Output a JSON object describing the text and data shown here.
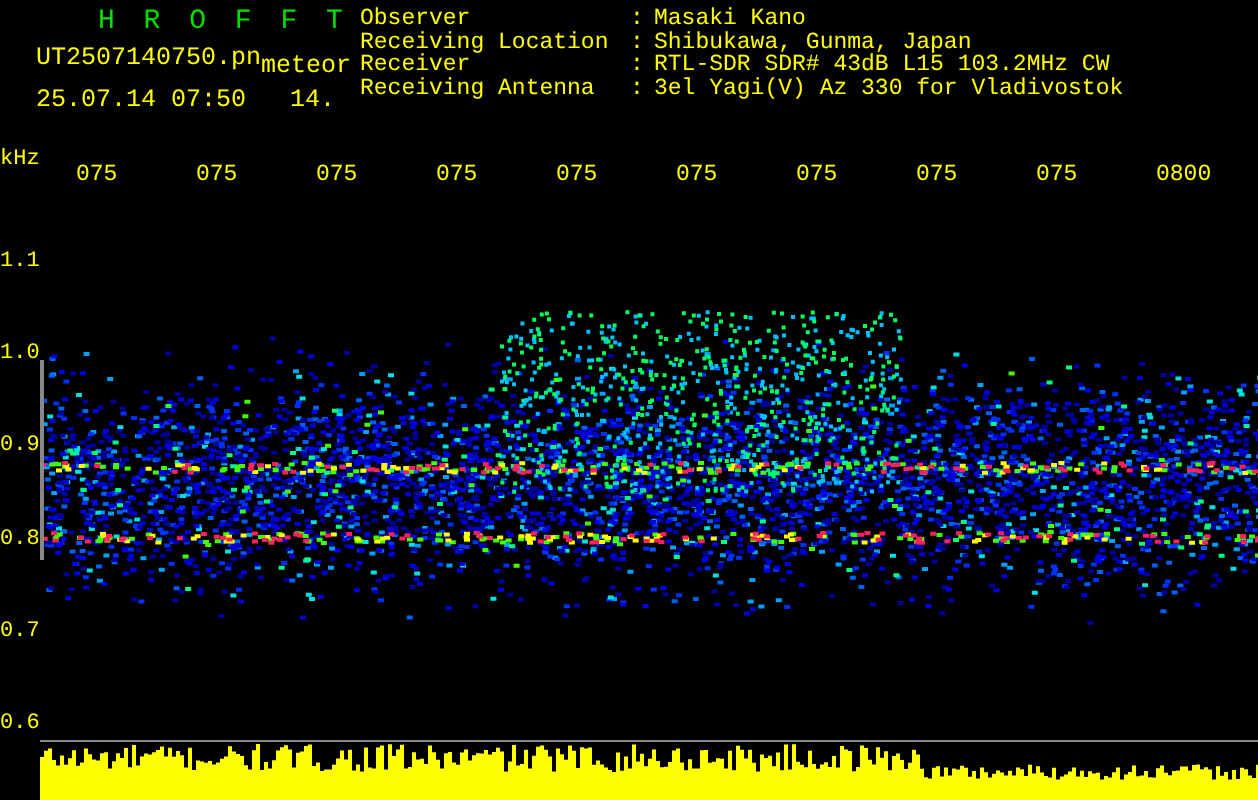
{
  "header": {
    "title": "H R O F F T",
    "filename": "UT2507140750.pn",
    "mode": "meteor",
    "timestamp": "25.07.14 07:50",
    "count": "14."
  },
  "station": [
    {
      "label": "Observer",
      "separator": ":",
      "value": "Masaki Kano"
    },
    {
      "label": "Receiving Location",
      "separator": ":",
      "value": "Shibukawa, Gunma, Japan"
    },
    {
      "label": "Receiver",
      "separator": ":",
      "value": "RTL-SDR SDR# 43dB L15 103.2MHz CW"
    },
    {
      "label": "Receiving Antenna",
      "separator": ":",
      "value": "3el Yagi(V) Az 330 for Vladivostok"
    }
  ],
  "time_axis": {
    "unit": "kHz",
    "ticks": [
      "075",
      "075",
      "075",
      "075",
      "075",
      "075",
      "075",
      "075",
      "075",
      "0800"
    ]
  },
  "freq_axis": {
    "ticks": [
      "1.1",
      "1.0",
      "0.9",
      "0.8",
      "0.7",
      "0.6"
    ]
  }
}
